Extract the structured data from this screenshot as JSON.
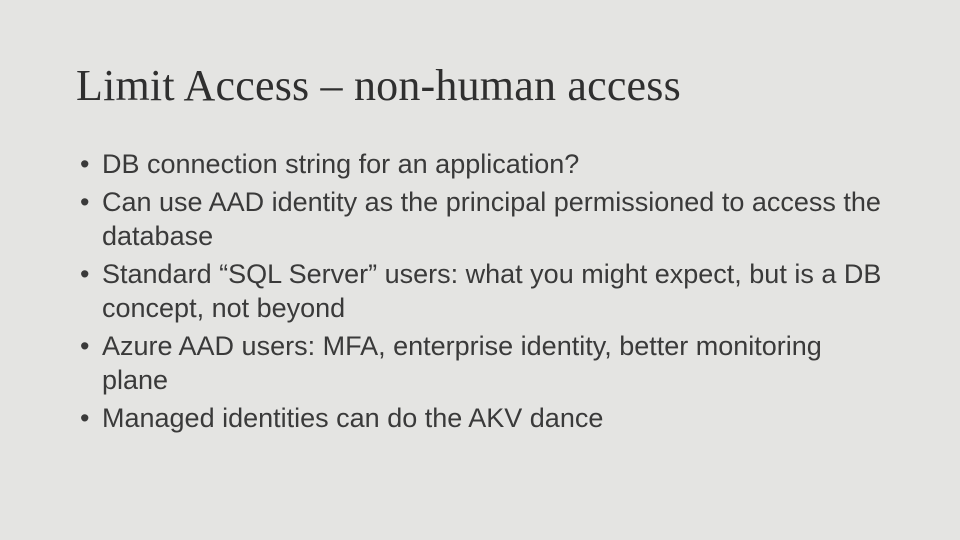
{
  "title": "Limit Access – non-human access",
  "bullets": [
    "DB connection string for an application?",
    "Can use AAD identity as the principal permissioned to access the database",
    "Standard “SQL Server” users: what you might expect, but is a DB concept, not beyond",
    "Azure AAD users: MFA, enterprise identity, better monitoring plane",
    "Managed identities can do the AKV dance"
  ]
}
